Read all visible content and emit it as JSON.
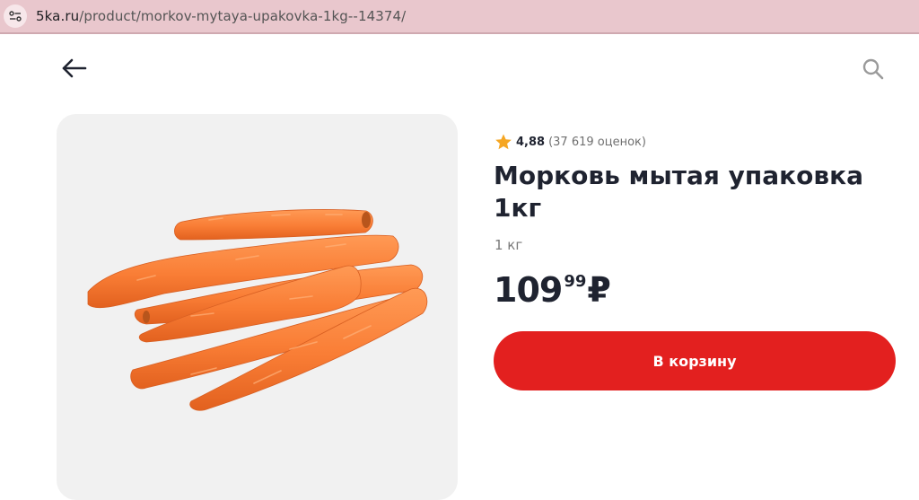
{
  "browser": {
    "url_domain": "5ka.ru",
    "url_path": "/product/morkov-mytaya-upakovka-1kg--14374/"
  },
  "header": {
    "back_icon": "arrow-left-icon",
    "search_icon": "search-icon"
  },
  "product": {
    "image_alt": "carrots",
    "rating_value": "4,88",
    "rating_count": "(37 619 оценок)",
    "title": "Морковь мытая упаковка 1кг",
    "weight": "1 кг",
    "price_rubles": "109",
    "price_kopecks": "99",
    "currency": "₽",
    "add_to_cart_label": "В корзину"
  },
  "colors": {
    "accent": "#e3201f",
    "star": "#f5a623",
    "text_dark": "#1f2330",
    "address_bar": "#e9c7cd"
  }
}
